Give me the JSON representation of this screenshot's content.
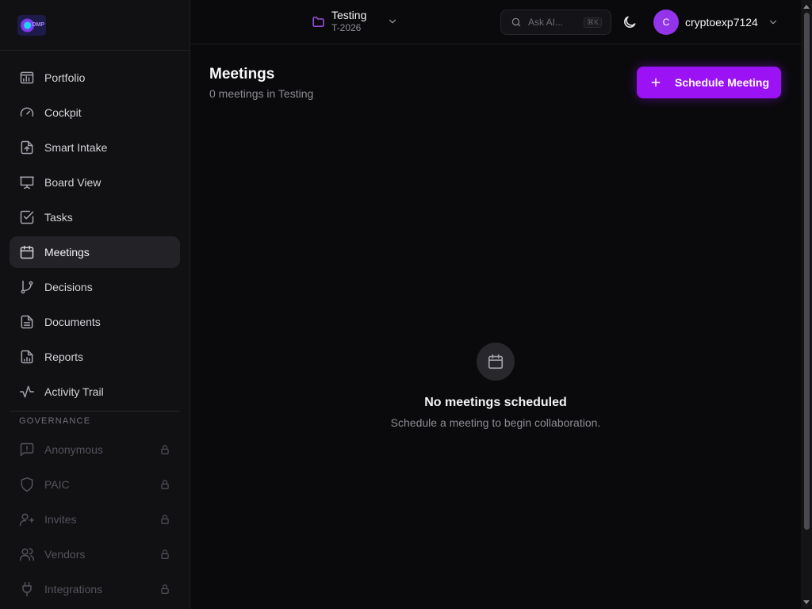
{
  "brand": {
    "logo_text": "DMP"
  },
  "sidebar": {
    "items": [
      {
        "label": "Portfolio",
        "icon": "portfolio-icon"
      },
      {
        "label": "Cockpit",
        "icon": "gauge-icon"
      },
      {
        "label": "Smart Intake",
        "icon": "file-upload-icon"
      },
      {
        "label": "Board View",
        "icon": "presentation-icon"
      },
      {
        "label": "Tasks",
        "icon": "checkbox-icon"
      },
      {
        "label": "Meetings",
        "icon": "calendar-icon",
        "active": true
      },
      {
        "label": "Decisions",
        "icon": "git-branch-icon"
      },
      {
        "label": "Documents",
        "icon": "document-icon"
      },
      {
        "label": "Reports",
        "icon": "report-icon"
      },
      {
        "label": "Activity Trail",
        "icon": "activity-icon"
      }
    ],
    "governance_label": "GOVERNANCE",
    "governance_items": [
      {
        "label": "Anonymous",
        "icon": "message-alert-icon",
        "locked": true
      },
      {
        "label": "PAIC",
        "icon": "shield-icon",
        "locked": true
      },
      {
        "label": "Invites",
        "icon": "user-plus-icon",
        "locked": true
      },
      {
        "label": "Vendors",
        "icon": "users-icon",
        "locked": true
      },
      {
        "label": "Integrations",
        "icon": "plug-icon",
        "locked": true
      }
    ]
  },
  "topbar": {
    "project_name": "Testing",
    "project_code": "T-2026",
    "search_placeholder": "Ask AI...",
    "search_shortcut": "⌘K",
    "theme_icon": "moon-icon",
    "user_initial": "C",
    "username": "cryptoexp7124"
  },
  "main": {
    "title": "Meetings",
    "subtitle": "0 meetings in Testing",
    "primary_button": "Schedule Meeting",
    "empty_title": "No meetings scheduled",
    "empty_subtitle": "Schedule a meeting to begin collaboration."
  },
  "colors": {
    "accent": "#9b12f5",
    "background": "#0a0a0c",
    "sidebar": "#111114",
    "avatar": "#9333ea",
    "folder_icon": "#a855f7"
  }
}
